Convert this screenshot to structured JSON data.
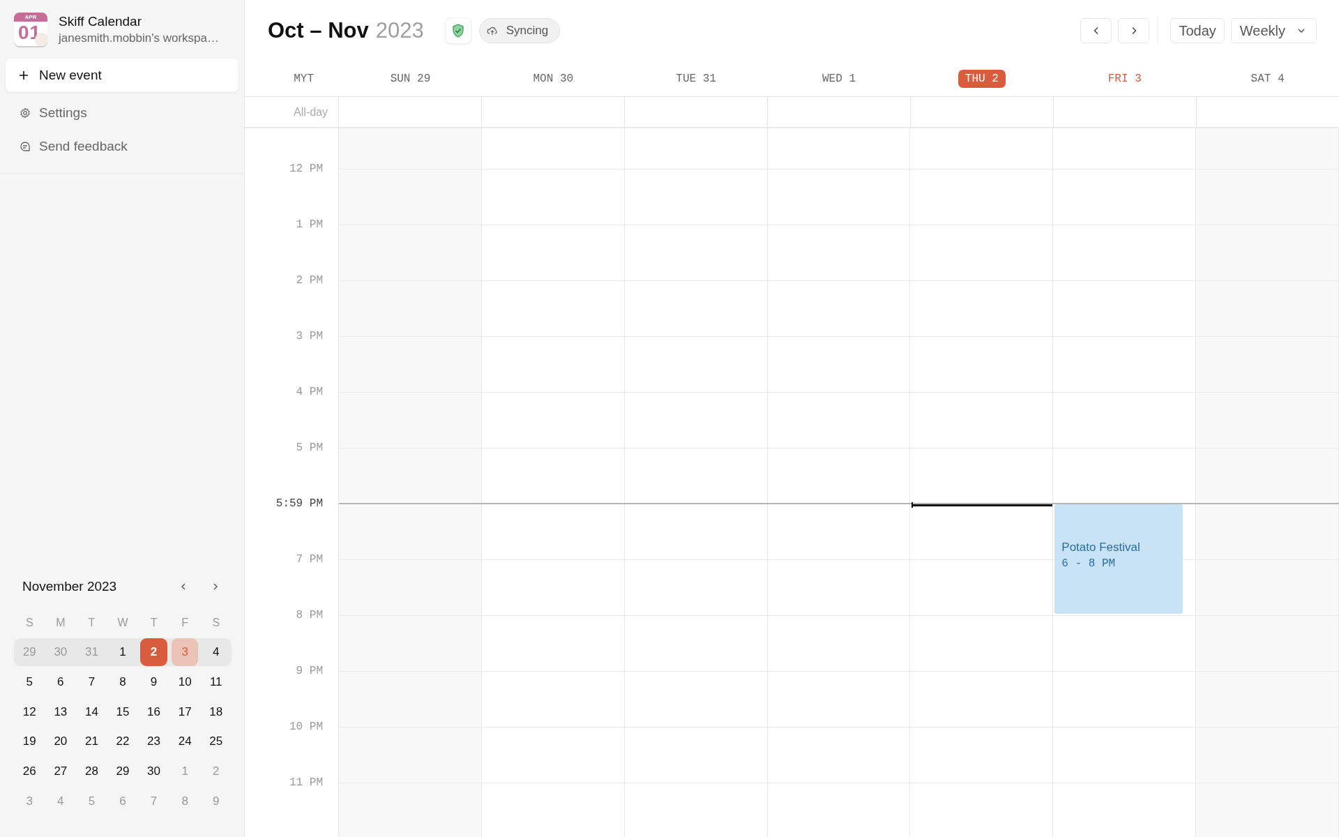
{
  "sidebar": {
    "app": {
      "logo_month": "APR",
      "logo_day": "01",
      "name": "Skiff Calendar",
      "workspace": "janesmith.mobbin's workspa…"
    },
    "new_event": "New event",
    "menu": [
      {
        "kind": "settings",
        "label": "Settings"
      },
      {
        "kind": "feedback",
        "label": "Send feedback"
      }
    ],
    "mini_calendar": {
      "title": "November 2023",
      "weekdays": [
        "S",
        "M",
        "T",
        "W",
        "T",
        "F",
        "S"
      ],
      "weeks": [
        {
          "current": true,
          "days": [
            {
              "label": "29",
              "outside": true,
              "today": false,
              "selected": false
            },
            {
              "label": "30",
              "outside": true,
              "today": false,
              "selected": false
            },
            {
              "label": "31",
              "outside": true,
              "today": false,
              "selected": false
            },
            {
              "label": "1",
              "outside": false,
              "today": false,
              "selected": false
            },
            {
              "label": "2",
              "outside": false,
              "today": true,
              "selected": false
            },
            {
              "label": "3",
              "outside": false,
              "today": false,
              "selected": true
            },
            {
              "label": "4",
              "outside": false,
              "today": false,
              "selected": false
            }
          ]
        },
        {
          "current": false,
          "days": [
            {
              "label": "5",
              "outside": false,
              "today": false,
              "selected": false
            },
            {
              "label": "6",
              "outside": false,
              "today": false,
              "selected": false
            },
            {
              "label": "7",
              "outside": false,
              "today": false,
              "selected": false
            },
            {
              "label": "8",
              "outside": false,
              "today": false,
              "selected": false
            },
            {
              "label": "9",
              "outside": false,
              "today": false,
              "selected": false
            },
            {
              "label": "10",
              "outside": false,
              "today": false,
              "selected": false
            },
            {
              "label": "11",
              "outside": false,
              "today": false,
              "selected": false
            }
          ]
        },
        {
          "current": false,
          "days": [
            {
              "label": "12",
              "outside": false,
              "today": false,
              "selected": false
            },
            {
              "label": "13",
              "outside": false,
              "today": false,
              "selected": false
            },
            {
              "label": "14",
              "outside": false,
              "today": false,
              "selected": false
            },
            {
              "label": "15",
              "outside": false,
              "today": false,
              "selected": false
            },
            {
              "label": "16",
              "outside": false,
              "today": false,
              "selected": false
            },
            {
              "label": "17",
              "outside": false,
              "today": false,
              "selected": false
            },
            {
              "label": "18",
              "outside": false,
              "today": false,
              "selected": false
            }
          ]
        },
        {
          "current": false,
          "days": [
            {
              "label": "19",
              "outside": false,
              "today": false,
              "selected": false
            },
            {
              "label": "20",
              "outside": false,
              "today": false,
              "selected": false
            },
            {
              "label": "21",
              "outside": false,
              "today": false,
              "selected": false
            },
            {
              "label": "22",
              "outside": false,
              "today": false,
              "selected": false
            },
            {
              "label": "23",
              "outside": false,
              "today": false,
              "selected": false
            },
            {
              "label": "24",
              "outside": false,
              "today": false,
              "selected": false
            },
            {
              "label": "25",
              "outside": false,
              "today": false,
              "selected": false
            }
          ]
        },
        {
          "current": false,
          "days": [
            {
              "label": "26",
              "outside": false,
              "today": false,
              "selected": false
            },
            {
              "label": "27",
              "outside": false,
              "today": false,
              "selected": false
            },
            {
              "label": "28",
              "outside": false,
              "today": false,
              "selected": false
            },
            {
              "label": "29",
              "outside": false,
              "today": false,
              "selected": false
            },
            {
              "label": "30",
              "outside": false,
              "today": false,
              "selected": false
            },
            {
              "label": "1",
              "outside": true,
              "today": false,
              "selected": false
            },
            {
              "label": "2",
              "outside": true,
              "today": false,
              "selected": false
            }
          ]
        },
        {
          "current": false,
          "days": [
            {
              "label": "3",
              "outside": true,
              "today": false,
              "selected": false
            },
            {
              "label": "4",
              "outside": true,
              "today": false,
              "selected": false
            },
            {
              "label": "5",
              "outside": true,
              "today": false,
              "selected": false
            },
            {
              "label": "6",
              "outside": true,
              "today": false,
              "selected": false
            },
            {
              "label": "7",
              "outside": true,
              "today": false,
              "selected": false
            },
            {
              "label": "8",
              "outside": true,
              "today": false,
              "selected": false
            },
            {
              "label": "9",
              "outside": true,
              "today": false,
              "selected": false
            }
          ]
        }
      ]
    }
  },
  "header": {
    "title": "Oct – Nov",
    "year": "2023",
    "sync": "Syncing",
    "today": "Today",
    "view": "Weekly"
  },
  "calendar": {
    "timezone": "MYT",
    "all_day": "All-day",
    "days": [
      {
        "label": "SUN 29",
        "today": false,
        "selected": false,
        "weekend": true
      },
      {
        "label": "MON 30",
        "today": false,
        "selected": false,
        "weekend": false
      },
      {
        "label": "TUE 31",
        "today": false,
        "selected": false,
        "weekend": false
      },
      {
        "label": "WED 1",
        "today": false,
        "selected": false,
        "weekend": false
      },
      {
        "label": "THU 2",
        "today": true,
        "selected": false,
        "weekend": false
      },
      {
        "label": "FRI 3",
        "today": false,
        "selected": true,
        "weekend": false,
        "events": [
          {
            "title": "Potato Festival",
            "time": "6 - 8 PM"
          }
        ]
      },
      {
        "label": "SAT 4",
        "today": false,
        "selected": false,
        "weekend": true
      }
    ],
    "hours": [
      {
        "kind": "hour",
        "label": "12 PM"
      },
      {
        "kind": "hour",
        "label": "1 PM"
      },
      {
        "kind": "hour",
        "label": "2 PM"
      },
      {
        "kind": "hour",
        "label": "3 PM"
      },
      {
        "kind": "hour",
        "label": "4 PM"
      },
      {
        "kind": "hour",
        "label": "5 PM"
      },
      {
        "kind": "now",
        "label": "5:59 PM"
      },
      {
        "kind": "hour",
        "label": "7 PM"
      },
      {
        "kind": "hour",
        "label": "8 PM"
      },
      {
        "kind": "hour",
        "label": "9 PM"
      },
      {
        "kind": "hour",
        "label": "10 PM"
      },
      {
        "kind": "hour",
        "label": "11 PM"
      }
    ]
  }
}
